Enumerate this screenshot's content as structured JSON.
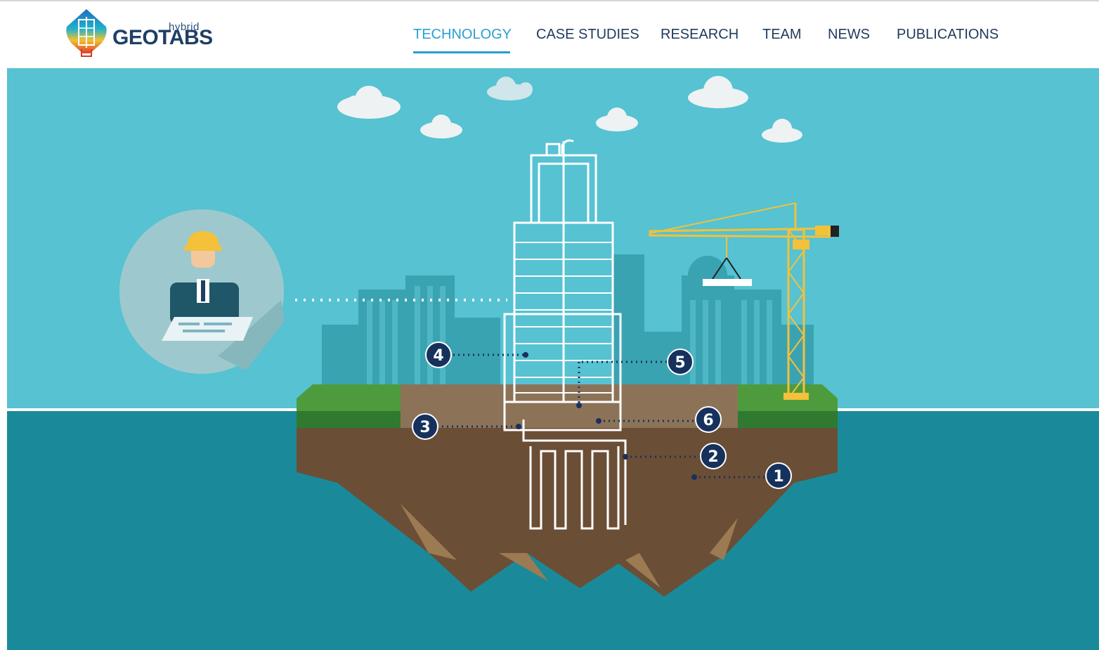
{
  "brand": {
    "super": "hybrid",
    "name": "GEOTABS",
    "colors": {
      "primary": "#1f3f66",
      "accent": "#2a9fcf"
    }
  },
  "nav": {
    "items": [
      {
        "label": "TECHNOLOGY",
        "active": true
      },
      {
        "label": "CASE STUDIES",
        "active": false
      },
      {
        "label": "RESEARCH",
        "active": false
      },
      {
        "label": "TEAM",
        "active": false
      },
      {
        "label": "NEWS",
        "active": false
      },
      {
        "label": "PUBLICATIONS",
        "active": false
      }
    ]
  },
  "hero": {
    "markers": [
      "1",
      "2",
      "3",
      "4",
      "5",
      "6"
    ],
    "colors": {
      "sky": "#56c2d2",
      "water": "#1a8a9a",
      "soil": "#6b4e36",
      "grass": "#3f8a36",
      "crane": "#f3c13a",
      "marker": "#16315c"
    },
    "icons": [
      "engineer-icon",
      "building-icon",
      "crane-icon",
      "cloud-icon",
      "borehole-icon"
    ]
  }
}
